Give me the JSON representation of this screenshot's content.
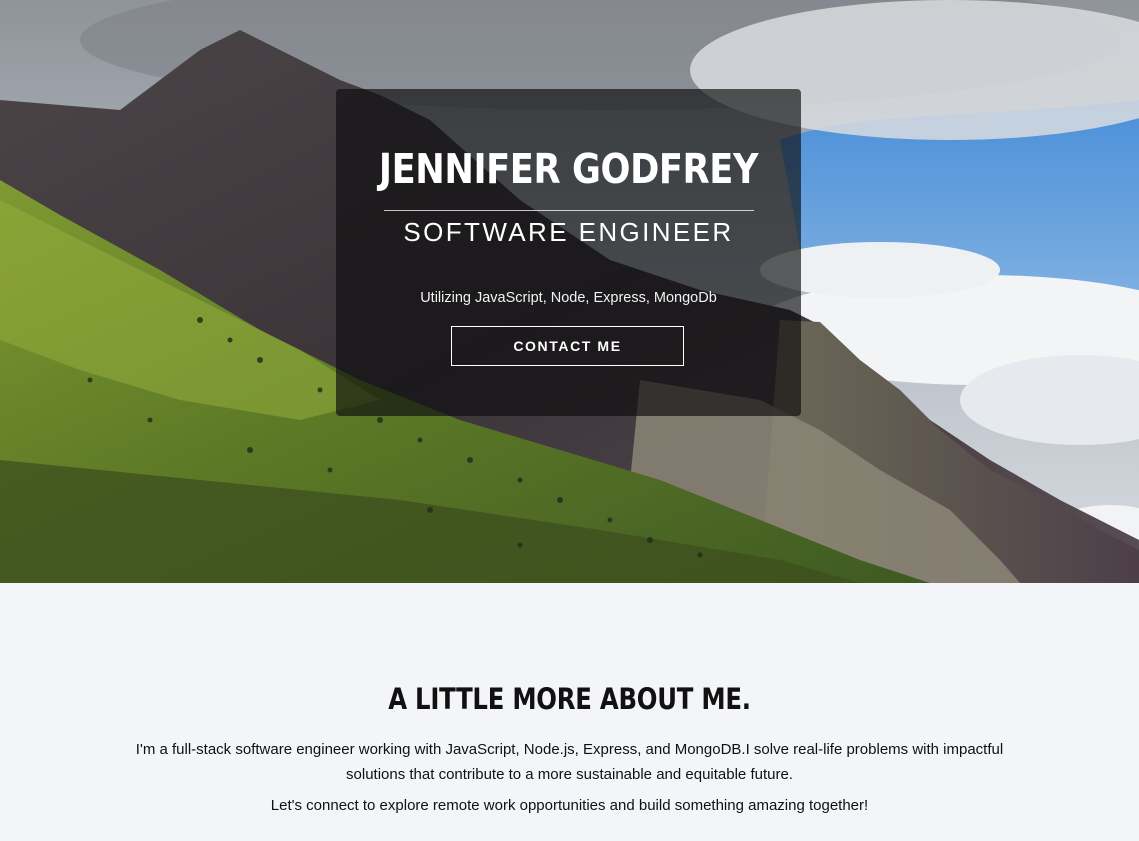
{
  "hero": {
    "name": "JENNIFER GODFREY",
    "role": "SOFTWARE ENGINEER",
    "tagline": "Utilizing JavaScript, Node, Express, MongoDb",
    "contact_label": "CONTACT ME",
    "background_image": "mountain-landscape"
  },
  "about": {
    "title": "A LITTLE MORE ABOUT ME.",
    "paragraph_1": "I'm a full-stack software engineer working with JavaScript, Node.js, Express, and MongoDB.I solve real-life problems with impactful solutions that contribute to a more sustainable and equitable future.",
    "paragraph_2": "Let's connect to explore remote work opportunities and build something amazing together!"
  },
  "colors": {
    "page_background": "#f3f5f9",
    "card_background": "#0c0c0e",
    "text_light": "#ffffff",
    "text_dark": "#111111",
    "sky_blue": "#3f86d4",
    "slope_green": "#6f8a2c"
  }
}
